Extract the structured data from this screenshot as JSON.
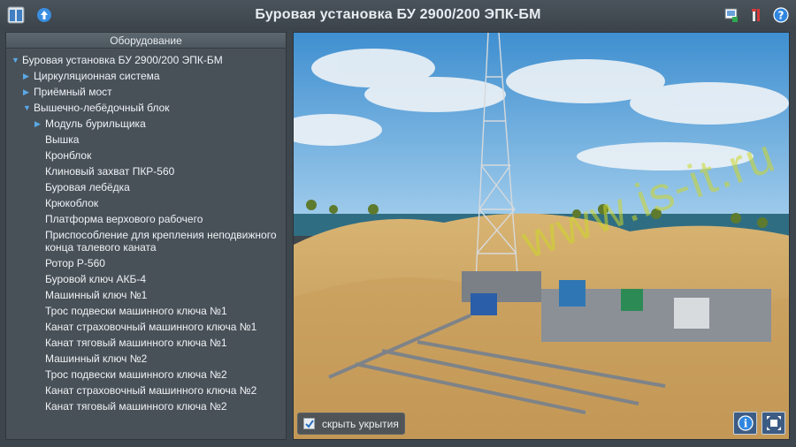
{
  "app": {
    "title": "Буровая установка БУ 2900/200 ЭПК-БМ"
  },
  "toolbar": {
    "left_icons": [
      "panel-toggle-icon",
      "arrow-up-icon"
    ],
    "right_icons": [
      "screen-export-icon",
      "tools-icon",
      "help-icon"
    ]
  },
  "equipment_panel": {
    "header": "Оборудование",
    "items": [
      {
        "label": "Буровая установка БУ 2900/200 ЭПК-БМ",
        "level": 0,
        "arrow": "expanded"
      },
      {
        "label": "Циркуляционная система",
        "level": 1,
        "arrow": "collapsed"
      },
      {
        "label": "Приёмный мост",
        "level": 1,
        "arrow": "collapsed"
      },
      {
        "label": "Вышечно-лебёдочный блок",
        "level": 1,
        "arrow": "expanded"
      },
      {
        "label": "Модуль бурильщика",
        "level": 2,
        "arrow": "collapsed"
      },
      {
        "label": "Вышка",
        "level": 2,
        "arrow": "none"
      },
      {
        "label": "Кронблок",
        "level": 2,
        "arrow": "none"
      },
      {
        "label": "Клиновый захват ПКР-560",
        "level": 2,
        "arrow": "none"
      },
      {
        "label": "Буровая лебёдка",
        "level": 2,
        "arrow": "none"
      },
      {
        "label": "Крюкоблок",
        "level": 2,
        "arrow": "none"
      },
      {
        "label": "Платформа верхового рабочего",
        "level": 2,
        "arrow": "none"
      },
      {
        "label": "Приспособление для крепления неподвижного конца талевого каната",
        "level": 2,
        "arrow": "none"
      },
      {
        "label": "Ротор Р-560",
        "level": 2,
        "arrow": "none"
      },
      {
        "label": "Буровой ключ АКБ-4",
        "level": 2,
        "arrow": "none"
      },
      {
        "label": "Машинный ключ №1",
        "level": 2,
        "arrow": "none"
      },
      {
        "label": "Трос подвески машинного ключа №1",
        "level": 2,
        "arrow": "none"
      },
      {
        "label": "Канат страховочный машинного ключа №1",
        "level": 2,
        "arrow": "none"
      },
      {
        "label": "Канат тяговый машинного ключа №1",
        "level": 2,
        "arrow": "none"
      },
      {
        "label": "Машинный ключ №2",
        "level": 2,
        "arrow": "none"
      },
      {
        "label": "Трос подвески машинного ключа №2",
        "level": 2,
        "arrow": "none"
      },
      {
        "label": "Канат страховочный машинного ключа №2",
        "level": 2,
        "arrow": "none"
      },
      {
        "label": "Канат тяговый машинного ключа №2",
        "level": 2,
        "arrow": "none"
      }
    ]
  },
  "viewport": {
    "hide_covers_label": "скрыть укрытия",
    "hide_covers_checked": true,
    "watermark": "www.is-it.ru",
    "buttons": [
      "info-icon",
      "fit-view-icon"
    ]
  },
  "colors": {
    "accent": "#5aa9e6",
    "background": "#3e464d",
    "panel": "#495158"
  }
}
